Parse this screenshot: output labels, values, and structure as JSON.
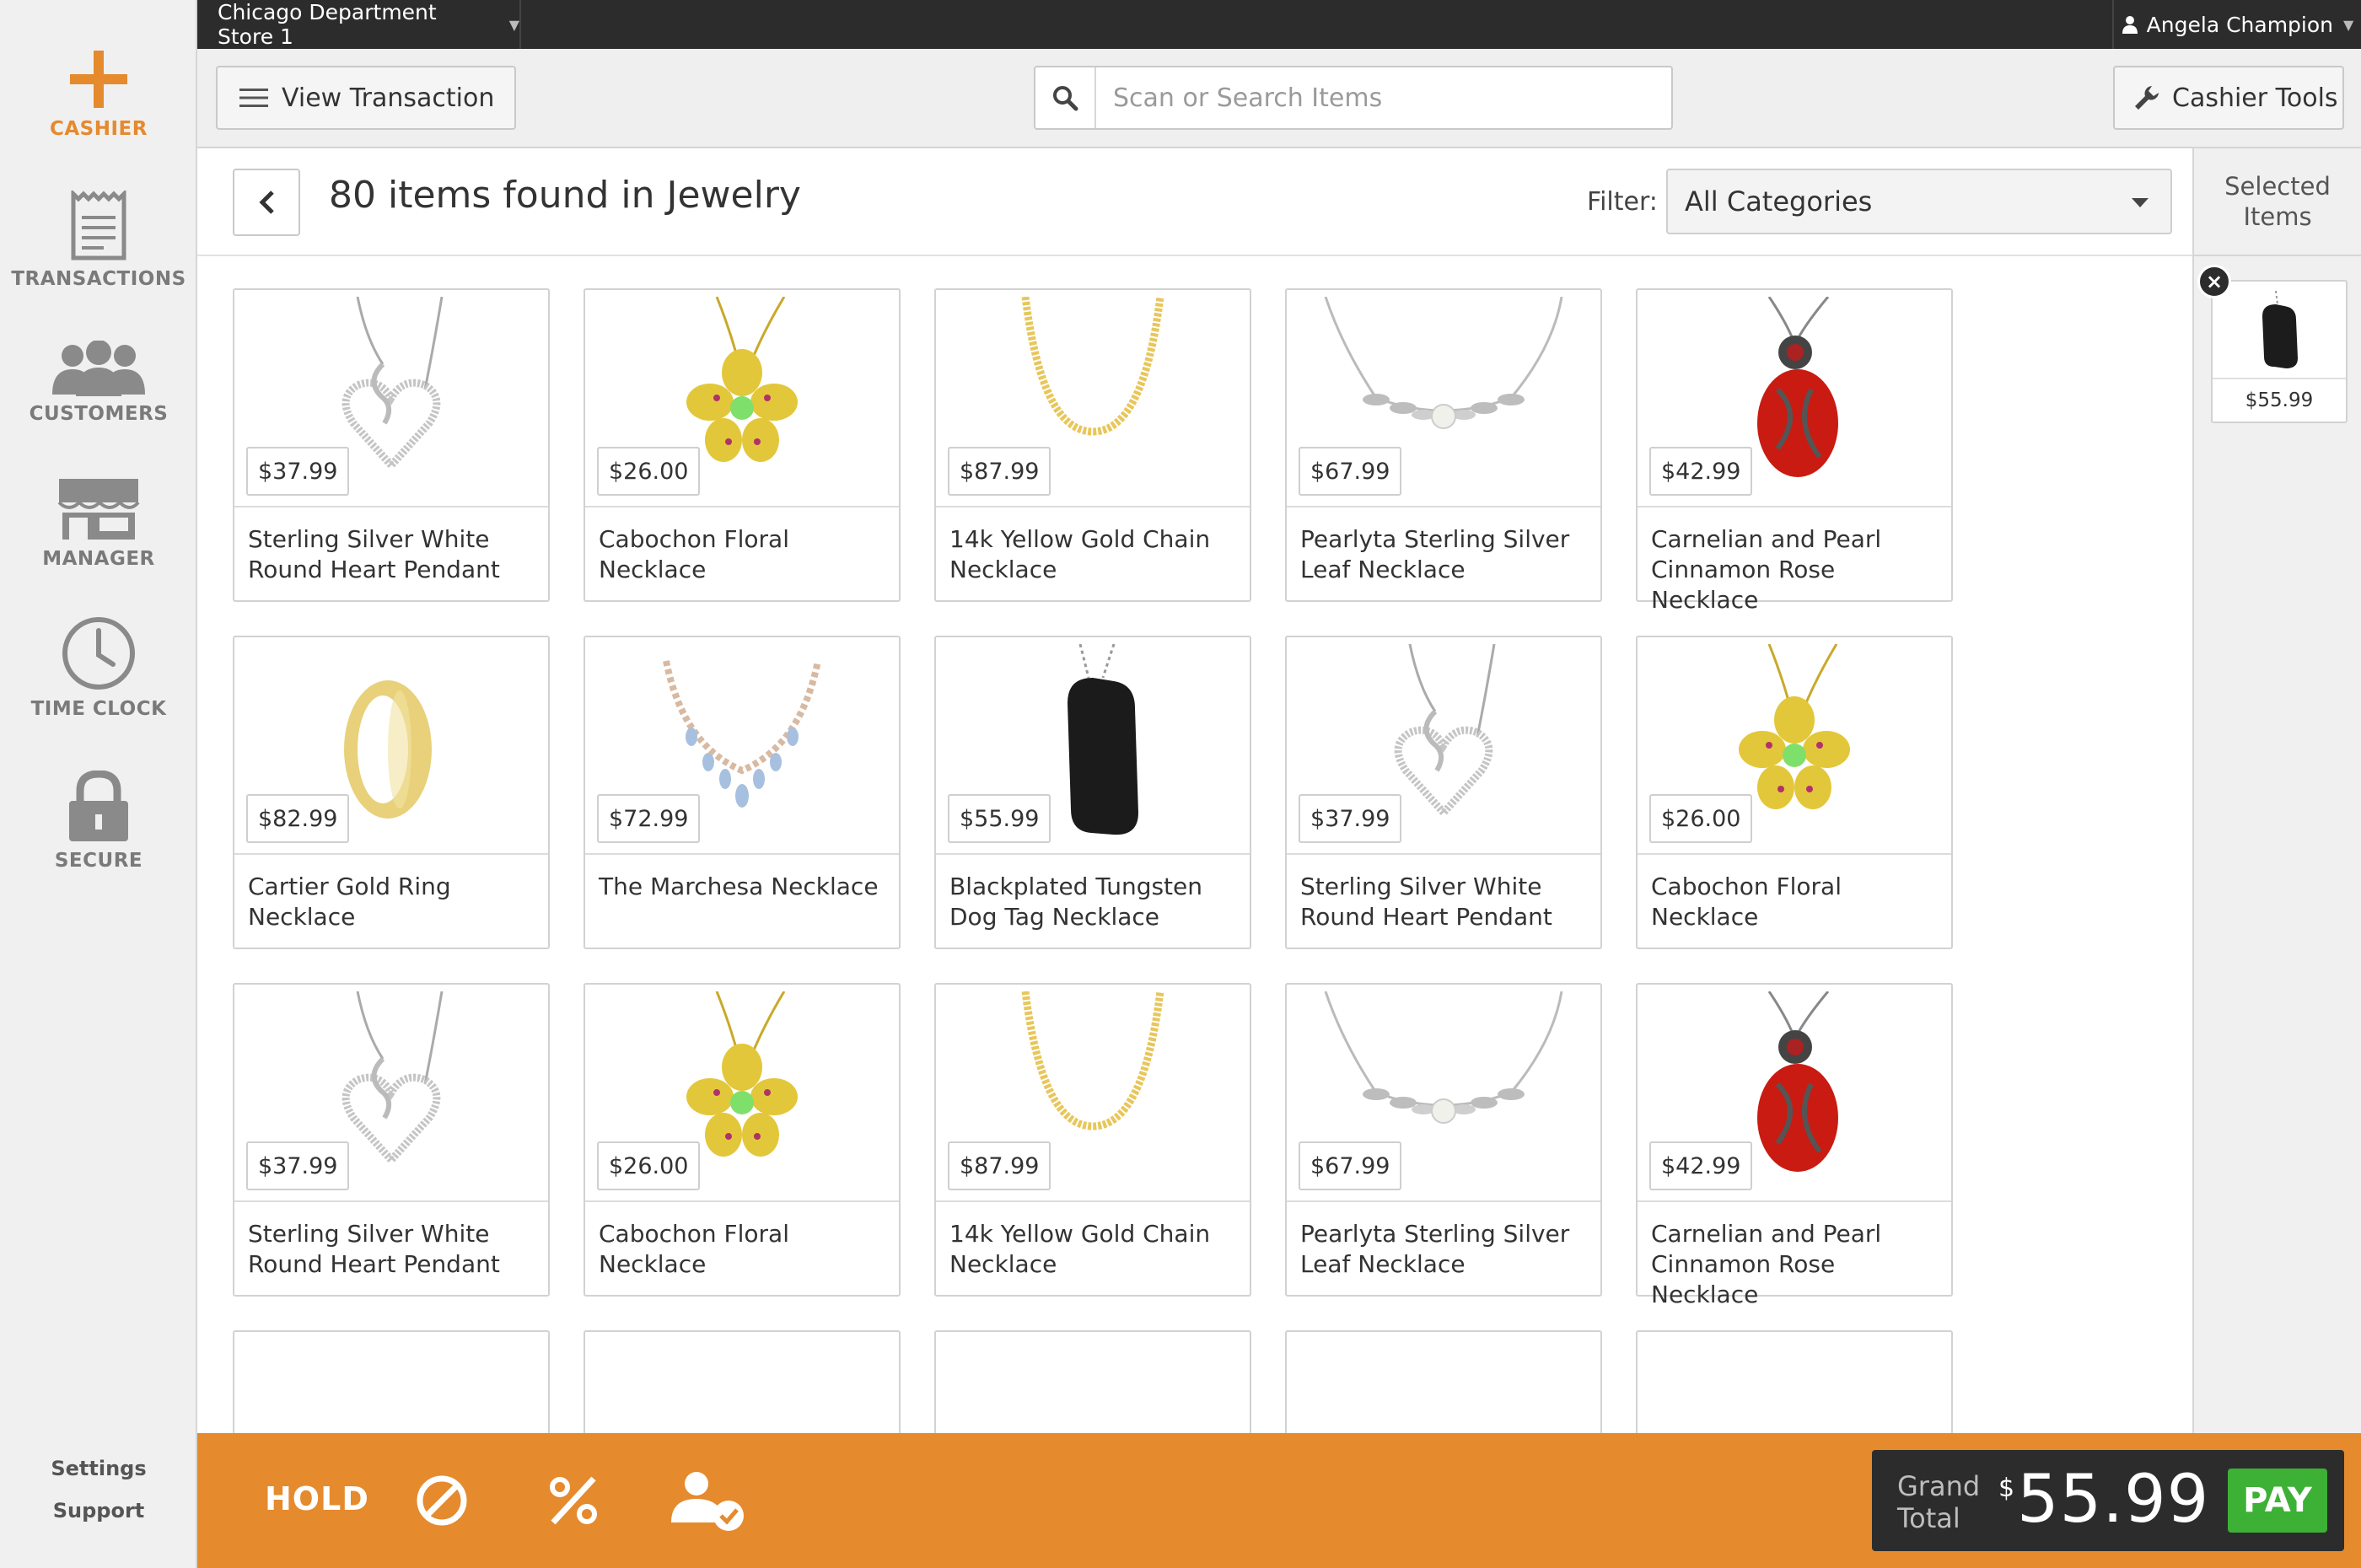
{
  "store": {
    "name": "Chicago Department Store 1"
  },
  "user": {
    "name": "Angela Champion"
  },
  "nav": {
    "items": [
      {
        "label": "CASHIER",
        "icon": "plus-icon",
        "active": true
      },
      {
        "label": "TRANSACTIONS",
        "icon": "receipt-icon",
        "active": false
      },
      {
        "label": "CUSTOMERS",
        "icon": "users-icon",
        "active": false
      },
      {
        "label": "MANAGER",
        "icon": "storefront-icon",
        "active": false
      },
      {
        "label": "TIME CLOCK",
        "icon": "clock-icon",
        "active": false
      },
      {
        "label": "SECURE",
        "icon": "lock-icon",
        "active": false
      }
    ],
    "settings_label": "Settings",
    "support_label": "Support"
  },
  "toolbar": {
    "view_transaction_label": "View Transaction",
    "search_placeholder": "Scan or Search Items",
    "search_value": "",
    "cashier_tools_label": "Cashier Tools"
  },
  "results": {
    "title": "80 items found in Jewelry",
    "filter_label": "Filter:",
    "filter_value": "All Categories"
  },
  "products": [
    {
      "name": "Sterling Silver White Round Heart Pendant",
      "price": "$37.99",
      "image": "silver-heart"
    },
    {
      "name": "Cabochon Floral Necklace",
      "price": "$26.00",
      "image": "flower"
    },
    {
      "name": "14k Yellow Gold Chain Necklace",
      "price": "$87.99",
      "image": "gold-chain"
    },
    {
      "name": "Pearlyta Sterling Silver Leaf Necklace",
      "price": "$67.99",
      "image": "leaf"
    },
    {
      "name": "Carnelian and Pearl Cinnamon Rose Necklace",
      "price": "$42.99",
      "image": "rose"
    },
    {
      "name": "Cartier Gold Ring Necklace",
      "price": "$82.99",
      "image": "ring"
    },
    {
      "name": "The Marchesa Necklace",
      "price": "$72.99",
      "image": "marchesa"
    },
    {
      "name": "Blackplated Tungsten Dog Tag Necklace",
      "price": "$55.99",
      "image": "dogtag"
    },
    {
      "name": "Sterling Silver White Round Heart Pendant",
      "price": "$37.99",
      "image": "silver-heart"
    },
    {
      "name": "Cabochon Floral Necklace",
      "price": "$26.00",
      "image": "flower"
    },
    {
      "name": "Sterling Silver White Round Heart Pendant",
      "price": "$37.99",
      "image": "silver-heart"
    },
    {
      "name": "Cabochon Floral Necklace",
      "price": "$26.00",
      "image": "flower"
    },
    {
      "name": "14k Yellow Gold Chain Necklace",
      "price": "$87.99",
      "image": "gold-chain"
    },
    {
      "name": "Pearlyta Sterling Silver Leaf Necklace",
      "price": "$67.99",
      "image": "leaf"
    },
    {
      "name": "Carnelian and Pearl Cinnamon Rose Necklace",
      "price": "$42.99",
      "image": "rose"
    }
  ],
  "selected": {
    "title": "Selected Items",
    "items": [
      {
        "price": "$55.99",
        "image": "dogtag"
      }
    ]
  },
  "footer": {
    "hold_label": "HOLD",
    "grand_total_label": "Grand Total",
    "currency": "$",
    "grand_total": "55.99",
    "pay_label": "PAY"
  },
  "colors": {
    "accent": "#e58a2d",
    "dark": "#2c2c2c",
    "pay": "#3db135"
  }
}
